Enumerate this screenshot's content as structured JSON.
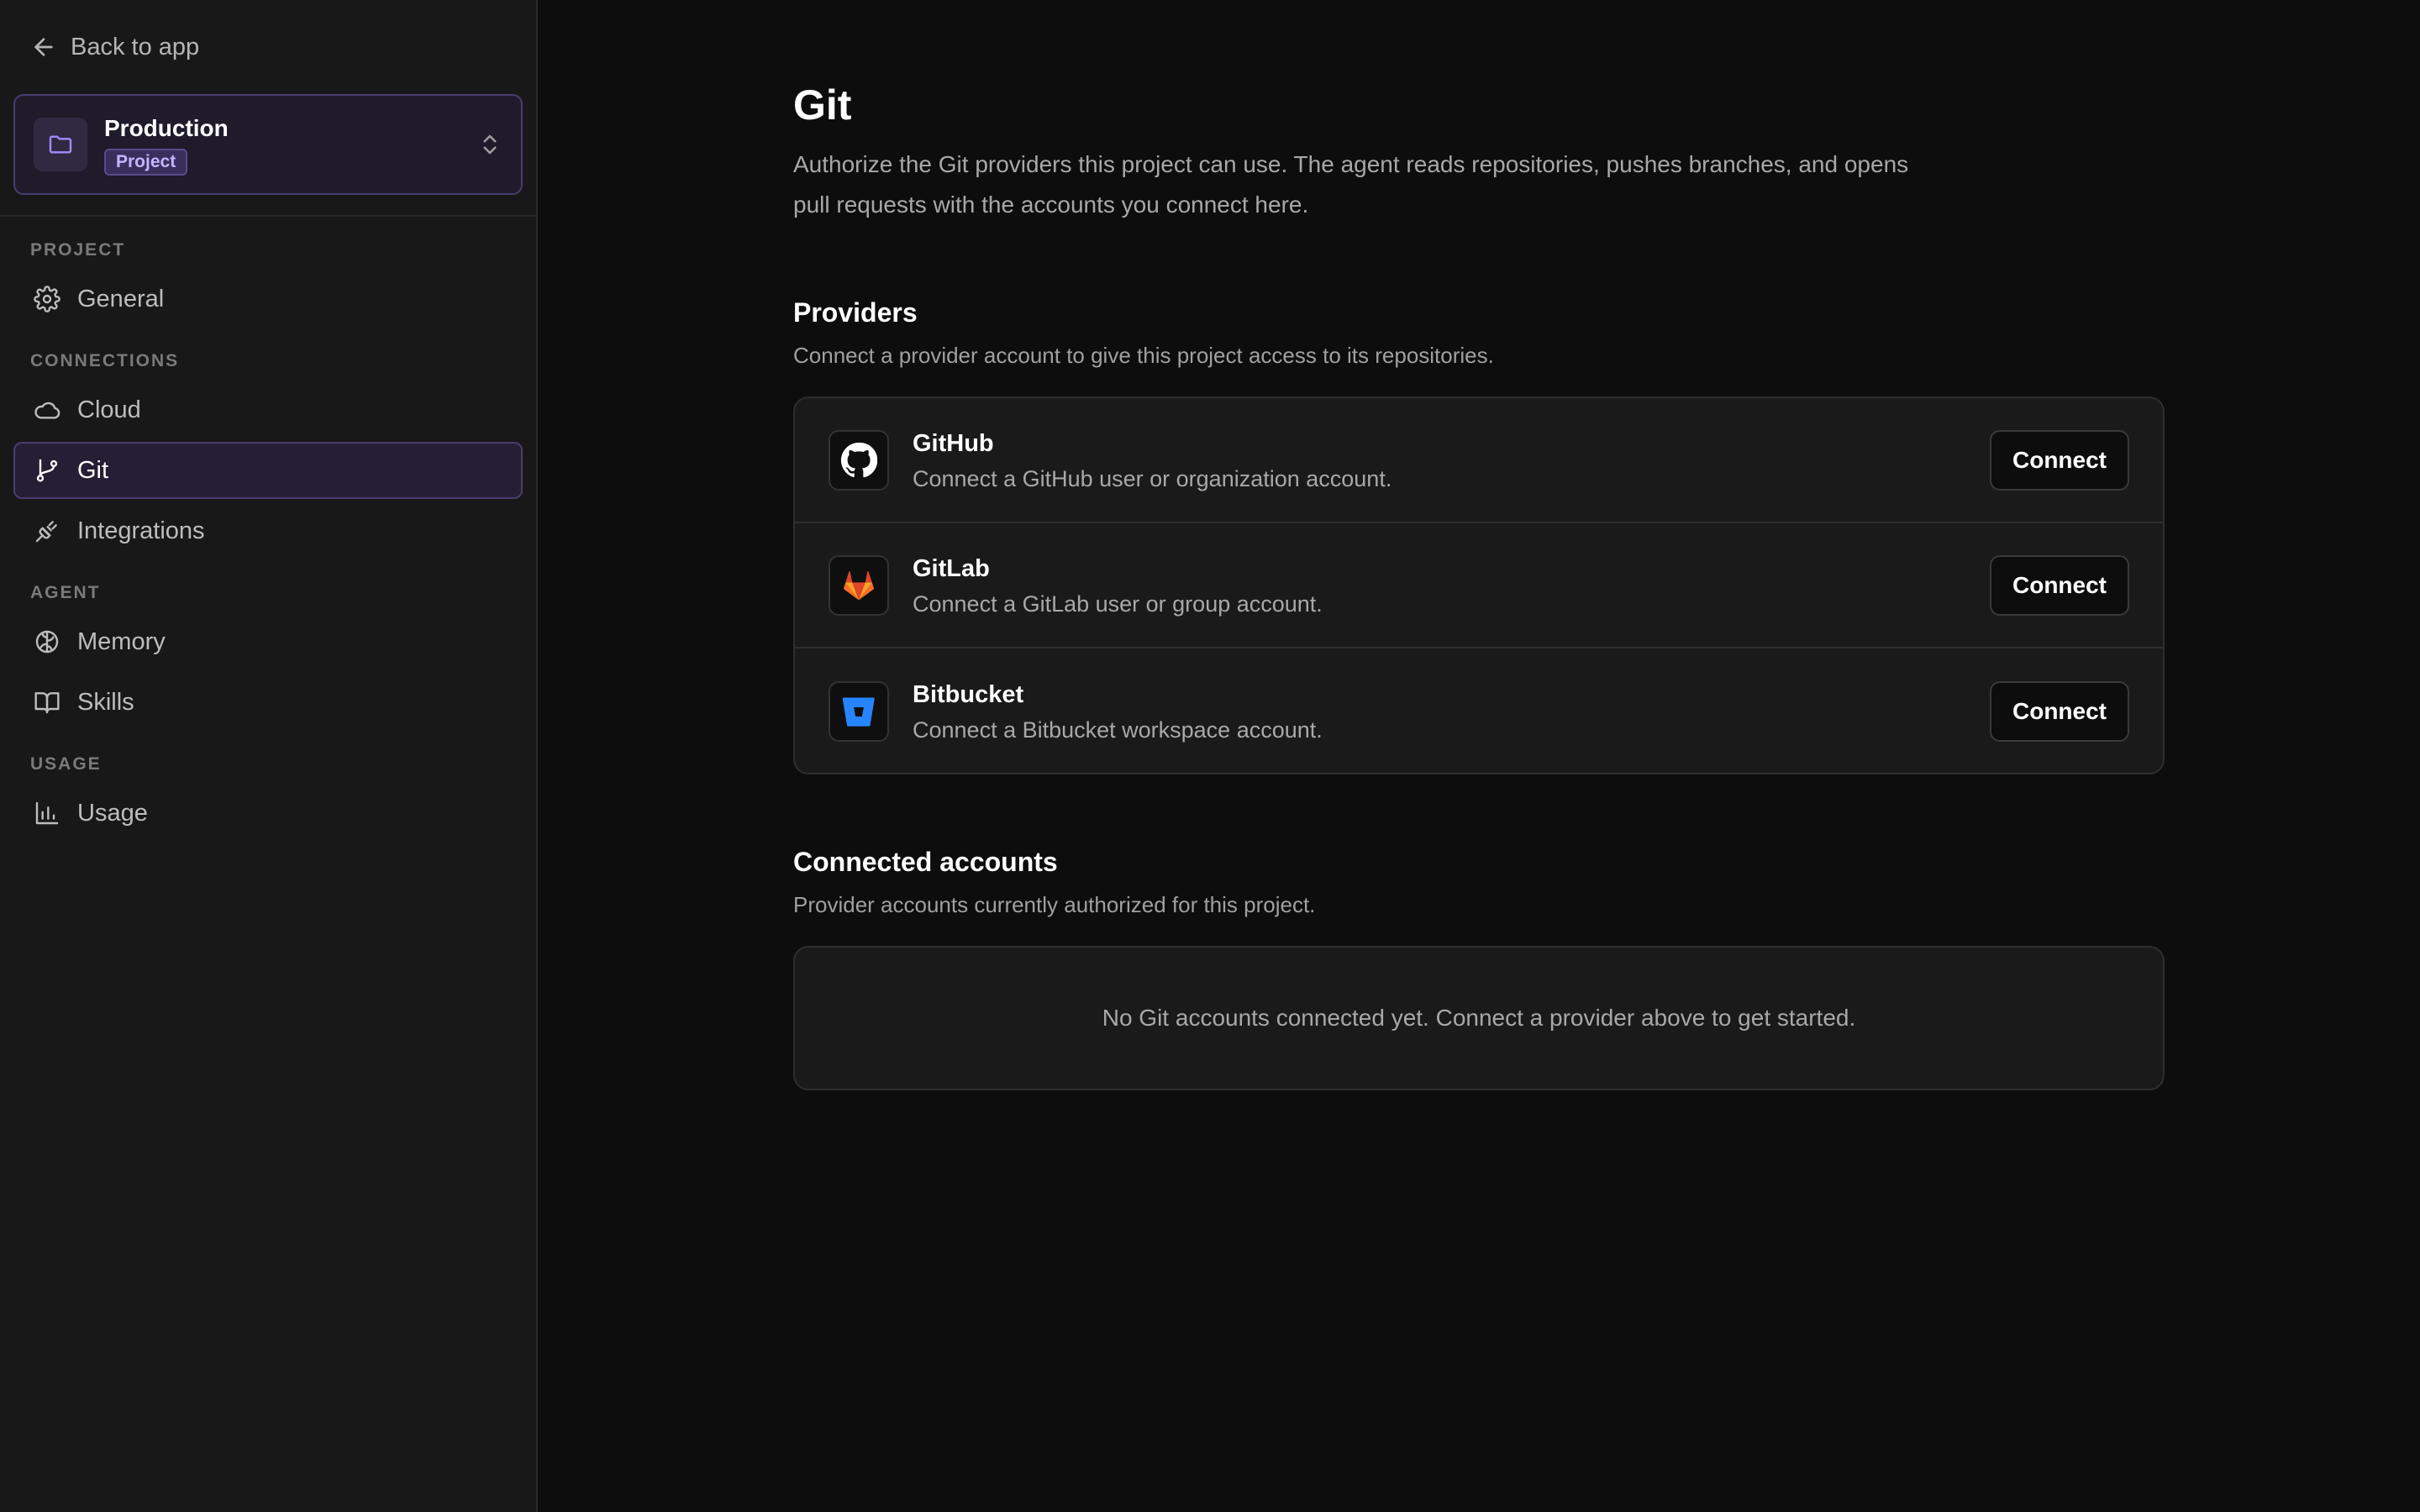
{
  "sidebar": {
    "back_label": "Back to app",
    "project": {
      "name": "Production",
      "badge": "Project"
    },
    "sections": [
      {
        "label": "PROJECT"
      },
      {
        "label": "CONNECTIONS"
      },
      {
        "label": "AGENT"
      },
      {
        "label": "USAGE"
      }
    ],
    "items": [
      {
        "label": "General",
        "icon": "gear-icon"
      },
      {
        "label": "Cloud",
        "icon": "cloud-icon"
      },
      {
        "label": "Git",
        "icon": "git-branch-icon",
        "active": true
      },
      {
        "label": "Integrations",
        "icon": "plug-icon"
      },
      {
        "label": "Memory",
        "icon": "brain-icon"
      },
      {
        "label": "Skills",
        "icon": "book-icon"
      },
      {
        "label": "Usage",
        "icon": "bar-chart-icon"
      }
    ]
  },
  "main": {
    "title": "Git",
    "description": "Authorize the Git providers this project can use. The agent reads repositories, pushes branches, and opens pull requests with the accounts you connect here.",
    "providers": {
      "title": "Providers",
      "description": "Connect a provider account to give this project access to its repositories.",
      "items": [
        {
          "name": "GitHub",
          "description": "Connect a GitHub user or organization account.",
          "button": "Connect",
          "icon": "github-icon"
        },
        {
          "name": "GitLab",
          "description": "Connect a GitLab user or group account.",
          "button": "Connect",
          "icon": "gitlab-icon"
        },
        {
          "name": "Bitbucket",
          "description": "Connect a Bitbucket workspace account.",
          "button": "Connect",
          "icon": "bitbucket-icon"
        }
      ]
    },
    "connected": {
      "title": "Connected accounts",
      "description": "Provider accounts currently authorized for this project.",
      "empty_message": "No Git accounts connected yet. Connect a provider above to get started."
    }
  },
  "colors": {
    "accent": "#4a3d70",
    "badge_text": "#c6b4ff",
    "gitlab_orange": "#fc6d26",
    "bitbucket_blue": "#2684ff"
  }
}
